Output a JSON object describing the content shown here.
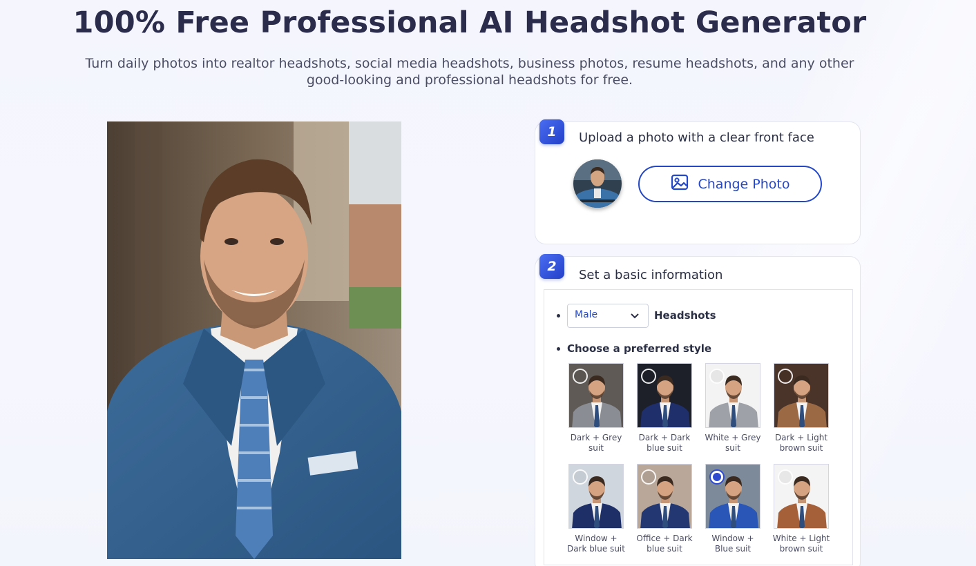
{
  "title": "100% Free Professional AI Headshot Generator",
  "subtitle_line1": "Turn daily photos into realtor headshots, social media headshots, business photos, resume headshots, and any other",
  "subtitle_line2": "good-looking and professional headshots for free.",
  "step1": {
    "number": "1",
    "title": "Upload a photo with a clear front face",
    "button_label": "Change Photo",
    "button_icon": "image-icon"
  },
  "step2": {
    "number": "2",
    "title": "Set a basic information",
    "gender_selected": "Male",
    "headshots_label": "Headshots",
    "style_prompt": "Choose a preferred style",
    "styles": [
      {
        "caption_l1": "Dark + Grey",
        "caption_l2": "suit",
        "selected": false,
        "bg": "#5f5a56",
        "suit": "#8a8d93"
      },
      {
        "caption_l1": "Dark + Dark",
        "caption_l2": "blue suit",
        "selected": false,
        "bg": "#1d2029",
        "suit": "#1f2f6b"
      },
      {
        "caption_l1": "White + Grey",
        "caption_l2": "suit",
        "selected": false,
        "bg": "#f3f3f3",
        "suit": "#9ea1a7"
      },
      {
        "caption_l1": "Dark + Light",
        "caption_l2": "brown suit",
        "selected": false,
        "bg": "#4a3328",
        "suit": "#9b6a45"
      },
      {
        "caption_l1": "Window +",
        "caption_l2": "Dark blue suit",
        "selected": false,
        "bg": "#cfd6de",
        "suit": "#1e2f68"
      },
      {
        "caption_l1": "Office + Dark",
        "caption_l2": "blue suit",
        "selected": false,
        "bg": "#b9a89a",
        "suit": "#233772"
      },
      {
        "caption_l1": "Window +",
        "caption_l2": "Blue suit",
        "selected": true,
        "bg": "#7d8a99",
        "suit": "#2a56b8"
      },
      {
        "caption_l1": "White + Light",
        "caption_l2": "brown suit",
        "selected": false,
        "bg": "#f4f4f4",
        "suit": "#a5603a"
      }
    ]
  },
  "colors": {
    "accent": "#2347c5",
    "title": "#2b2c4b",
    "text": "#4a4d63"
  }
}
